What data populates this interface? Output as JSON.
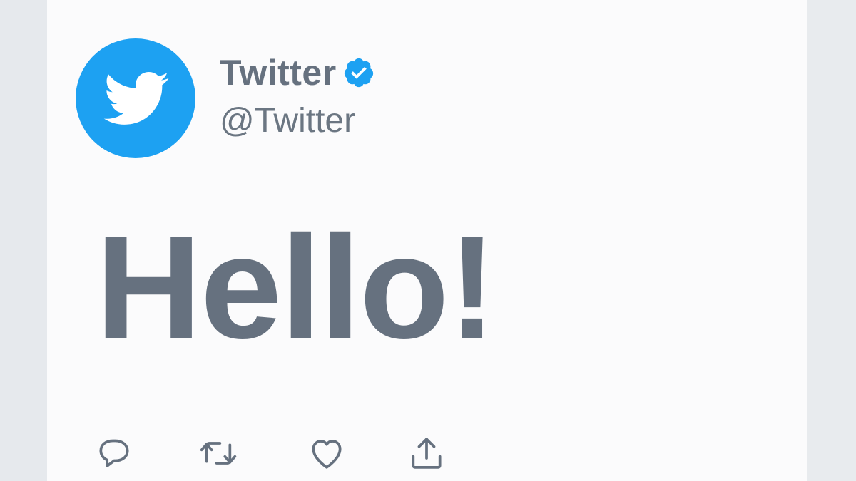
{
  "tweet": {
    "display_name": "Twitter",
    "handle": "@Twitter",
    "text": "Hello!",
    "verified": true
  },
  "avatar": {
    "icon": "twitter-bird-icon",
    "background_color": "#1da1f2"
  },
  "actions": [
    {
      "icon": "reply-icon"
    },
    {
      "icon": "retweet-icon"
    },
    {
      "icon": "like-icon"
    },
    {
      "icon": "share-icon"
    }
  ],
  "colors": {
    "text": "#66717f",
    "accent": "#1da1f2",
    "card": "#fbfbfc",
    "background": "#e9ecef"
  }
}
